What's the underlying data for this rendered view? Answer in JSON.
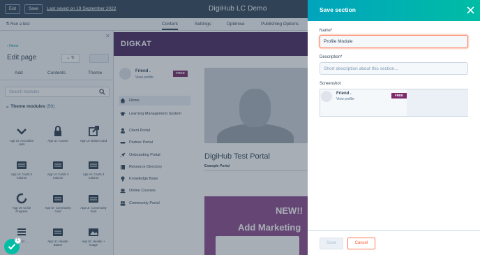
{
  "topbar": {
    "exit_label": "Exit",
    "save_label": "Save",
    "last_saved": "Last saved on 19 September 2022",
    "title": "DigiHub LC Demo"
  },
  "subbar": {
    "run_test": "Run a test",
    "tabs": [
      "Content",
      "Settings",
      "Optimise",
      "Publishing Options"
    ],
    "active_tab": "Content"
  },
  "left_panel": {
    "breadcrumb": "Home",
    "title": "Edit page",
    "tabs": [
      "Add",
      "Contents",
      "Theme"
    ],
    "search_placeholder": "Search modules",
    "section_title": "Theme modules",
    "section_count": "(56)",
    "modules": [
      {
        "label": "App UI: Accordion Lists",
        "icon": "chevron-down-icon"
      },
      {
        "label": "App UI: Access",
        "icon": "lock-icon"
      },
      {
        "label": "App UI: Button Card",
        "icon": "external-link-icon"
      },
      {
        "label": "App UI: Cards 2 Column",
        "icon": "card-icon"
      },
      {
        "label": "App UI: Cards 3 Column",
        "icon": "card-icon"
      },
      {
        "label": "App UI: Cards 4 Column",
        "icon": "card-icon"
      },
      {
        "label": "App UI: Circle Progress",
        "icon": "circle-progress-icon"
      },
      {
        "label": "App UI: Community Card",
        "icon": "card-icon"
      },
      {
        "label": "App UI: Community Post",
        "icon": "card-icon"
      },
      {
        "label": "App UI: ...",
        "icon": "list-icon"
      },
      {
        "label": "App UI: Header Button",
        "icon": "card-icon"
      },
      {
        "label": "App UI: Header + Image",
        "icon": "image-icon"
      }
    ]
  },
  "preview": {
    "logo": "DIGKAT",
    "friend_name": "Friend .",
    "view_profile": "View profile",
    "free_badge": "FREE",
    "nav_items": [
      {
        "label": "Home",
        "icon": "home-icon"
      },
      {
        "label": "Learning Management System",
        "icon": "graduation-icon"
      },
      {
        "label": "Client Portal",
        "icon": "user-icon"
      },
      {
        "label": "Partner Portal",
        "icon": "handshake-icon"
      },
      {
        "label": "Onboarding Portal",
        "icon": "rocket-icon"
      },
      {
        "label": "Resource Directory",
        "icon": "book-icon"
      },
      {
        "label": "Knowledge Base",
        "icon": "lightbulb-icon"
      },
      {
        "label": "Online Courses",
        "icon": "laptop-icon"
      },
      {
        "label": "Community Portal",
        "icon": "people-icon"
      }
    ],
    "portal_title": "DigiHub Test Portal",
    "example_portal": "Example Portal",
    "promo_new": "NEW!!",
    "promo_add": "Add Marketing"
  },
  "chat": {
    "badge": "1"
  },
  "dialog": {
    "title": "Save section",
    "name_label": "Name*",
    "name_value": "Profile Module",
    "description_label": "Description*",
    "description_placeholder": "Short description about this section...",
    "screenshot_label": "Screenshot",
    "screenshot": {
      "friend_name": "Friend .",
      "view_profile": "View profile",
      "free_badge": "FREE"
    },
    "save_button": "Save",
    "cancel_button": "Cancel"
  },
  "colors": {
    "header_bg": "#33475b",
    "dialog_header_start": "#00a4bd",
    "dialog_header_end": "#00bda5",
    "accent_orange": "#ff7a59",
    "banner_purple": "#4b2a63",
    "promo_purple": "#8e4b8e",
    "badge_purple": "#7b2a6a",
    "chat_green": "#00bda5"
  }
}
